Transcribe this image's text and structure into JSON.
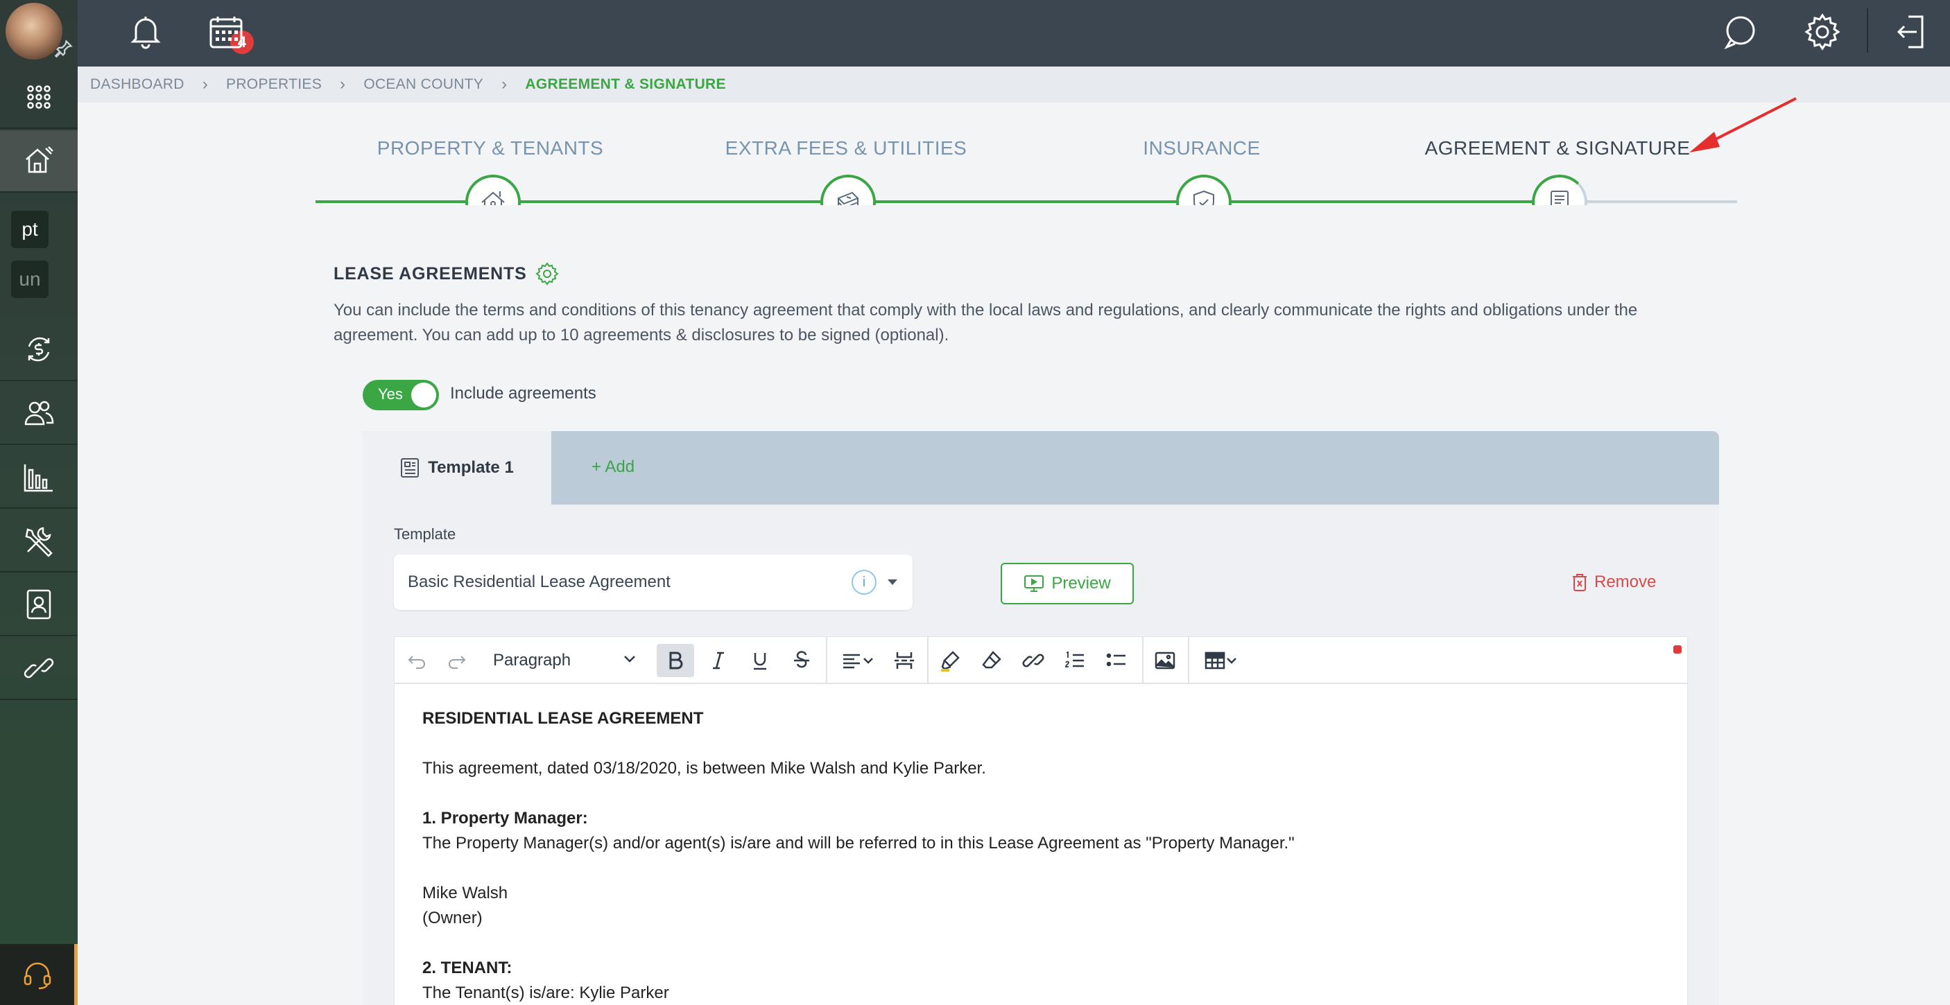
{
  "topbar": {
    "notification_count": "4"
  },
  "sidebar": {
    "chips": [
      "pt",
      "un"
    ]
  },
  "breadcrumb": {
    "items": [
      "DASHBOARD",
      "PROPERTIES",
      "OCEAN COUNTY"
    ],
    "current": "AGREEMENT & SIGNATURE"
  },
  "steps": [
    {
      "label": "PROPERTY & TENANTS",
      "icon": "house-icon",
      "status": "complete"
    },
    {
      "label": "EXTRA FEES & UTILITIES",
      "icon": "money-stack-icon",
      "status": "complete"
    },
    {
      "label": "INSURANCE",
      "icon": "shield-icon",
      "status": "complete"
    },
    {
      "label": "AGREEMENT & SIGNATURE",
      "icon": "document-icon",
      "status": "current"
    }
  ],
  "lease": {
    "title": "LEASE AGREEMENTS",
    "description": "You can include the terms and conditions of this tenancy agreement that comply with the local laws and regulations, and clearly communicate the rights and obligations under the agreement. You can add up to 10 agreements & disclosures to be signed (optional).",
    "toggle_value": "Yes",
    "toggle_label": "Include agreements"
  },
  "template": {
    "tab_label": "Template 1",
    "add_label": "Add",
    "field_label": "Template",
    "selected": "Basic Residential Lease Agreement",
    "info": "i",
    "preview_label": "Preview",
    "remove_label": "Remove"
  },
  "editor": {
    "block_format": "Paragraph",
    "content": {
      "heading": "RESIDENTIAL LEASE AGREEMENT",
      "intro": "This agreement, dated 03/18/2020, is between Mike Walsh and Kylie Parker.",
      "s1_title": "1. Property Manager:",
      "s1_text": "The Property Manager(s) and/or agent(s) is/are and will be referred to in this Lease Agreement as \"Property Manager.\"",
      "manager_name": "Mike Walsh",
      "manager_role": "(Owner)",
      "s2_title": "2. TENANT:",
      "s2_text": "The Tenant(s) is/are: Kylie Parker"
    }
  },
  "colors": {
    "accent": "#3aa644",
    "topbar": "#3b4650",
    "danger": "#d84a4a"
  }
}
